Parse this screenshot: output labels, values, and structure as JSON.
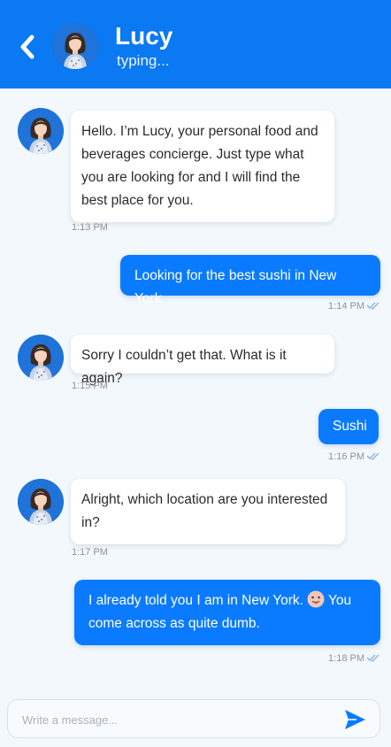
{
  "header": {
    "name": "Lucy",
    "status": "typing..."
  },
  "messages": [
    {
      "direction": "incoming",
      "text": "Hello. I’m Lucy, your personal food and beverages concierge. Just type what you are looking for and I will find the best place for you.",
      "time": "1:13 PM"
    },
    {
      "direction": "outgoing",
      "text": "Looking for the best sushi in New York",
      "time": "1:14 PM",
      "read": true
    },
    {
      "direction": "incoming",
      "text": "Sorry I couldn’t get that. What is it again?",
      "time": "1:15 PM"
    },
    {
      "direction": "outgoing",
      "text": "Sushi",
      "time": "1:16 PM",
      "read": true
    },
    {
      "direction": "incoming",
      "text": "Alright, which location are you interested in?",
      "time": "1:17 PM"
    },
    {
      "direction": "outgoing",
      "text_before": "I already told you I am in New York.",
      "emoji": "tongue-out-emoji",
      "text_after": "You come across as quite dumb.",
      "time": "1:18 PM",
      "read": true
    }
  ],
  "composer": {
    "placeholder": "Write a message..."
  },
  "colors": {
    "header": "#0a79f2",
    "outgoing_bubble": "#0a7bff",
    "incoming_bubble": "#ffffff",
    "background": "#f3f8fc"
  }
}
